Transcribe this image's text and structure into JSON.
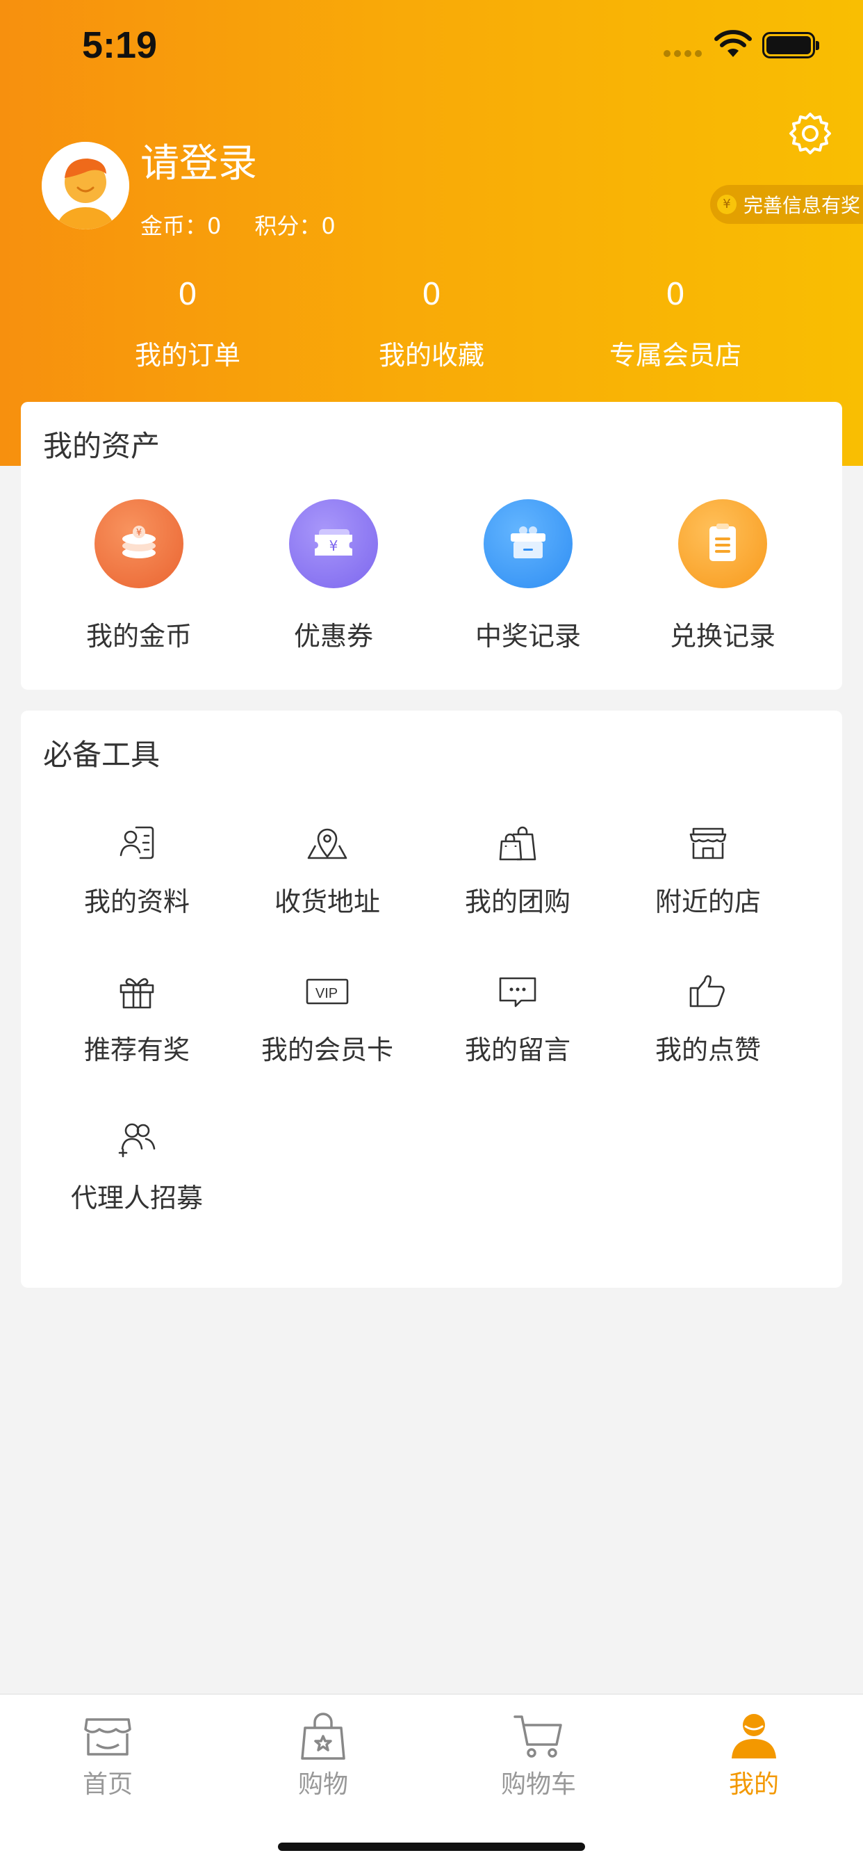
{
  "status_bar": {
    "time": "5:19"
  },
  "profile": {
    "login_prompt": "请登录",
    "coins_text": "金币：0",
    "points_text": "积分：0",
    "reward_badge": "完善信息有奖"
  },
  "stats": [
    {
      "value": "0",
      "label": "我的订单"
    },
    {
      "value": "0",
      "label": "我的收藏"
    },
    {
      "value": "0",
      "label": "专属会员店"
    }
  ],
  "assets": {
    "title": "我的资产",
    "items": [
      {
        "label": "我的金币",
        "icon": "coins-icon",
        "color": "#f07a40"
      },
      {
        "label": "优惠券",
        "icon": "coupon-icon",
        "color": "#8f7cf2"
      },
      {
        "label": "中奖记录",
        "icon": "prize-box-icon",
        "color": "#3b9cf6"
      },
      {
        "label": "兑换记录",
        "icon": "record-icon",
        "color": "#f9a52c"
      }
    ]
  },
  "tools": {
    "title": "必备工具",
    "items": [
      {
        "label": "我的资料",
        "icon": "profile-card-icon"
      },
      {
        "label": "收货地址",
        "icon": "location-icon"
      },
      {
        "label": "我的团购",
        "icon": "shopping-bags-icon"
      },
      {
        "label": "附近的店",
        "icon": "store-icon"
      },
      {
        "label": "推荐有奖",
        "icon": "gift-icon"
      },
      {
        "label": "我的会员卡",
        "icon": "vip-card-icon"
      },
      {
        "label": "我的留言",
        "icon": "message-icon"
      },
      {
        "label": "我的点赞",
        "icon": "thumbs-up-icon"
      },
      {
        "label": "代理人招募",
        "icon": "add-people-icon"
      }
    ]
  },
  "tabbar": {
    "items": [
      {
        "label": "首页",
        "icon": "home-store-icon",
        "active": false
      },
      {
        "label": "购物",
        "icon": "shopping-bag-icon",
        "active": false
      },
      {
        "label": "购物车",
        "icon": "cart-icon",
        "active": false
      },
      {
        "label": "我的",
        "icon": "person-icon",
        "active": true
      }
    ]
  },
  "colors": {
    "accent": "#f39800",
    "header_start": "#f7900e",
    "header_end": "#f9be02"
  }
}
